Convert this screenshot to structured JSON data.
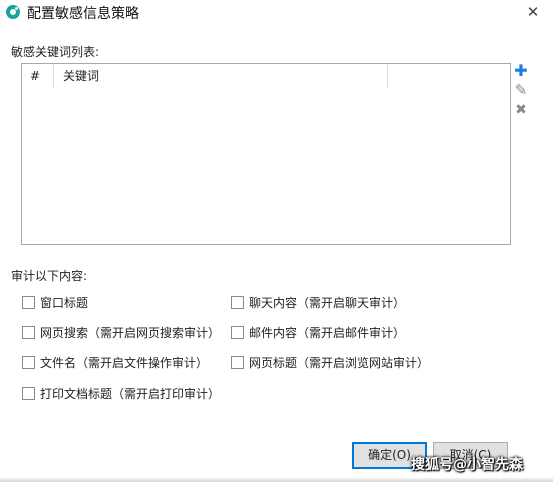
{
  "window": {
    "title": "配置敏感信息策略",
    "close_glyph": "✕",
    "app_icon": "app-logo-icon"
  },
  "keywords": {
    "label": "敏感关键词列表:",
    "columns": [
      "#",
      "关键词"
    ],
    "rows": [],
    "tools": {
      "add": {
        "icon": "plus-icon",
        "glyph": "✚",
        "color": "#1e7fd6"
      },
      "edit": {
        "icon": "pencil-icon",
        "glyph": "✎",
        "color": "#8a8a8a"
      },
      "delete": {
        "icon": "delete-x-icon",
        "glyph": "✖",
        "color": "#8a8a8a"
      }
    }
  },
  "audit": {
    "label": "审计以下内容:",
    "options": [
      {
        "label": "窗口标题",
        "checked": false
      },
      {
        "label": "聊天内容（需开启聊天审计）",
        "checked": false
      },
      {
        "label": "网页搜索（需开启网页搜索审计）",
        "checked": false
      },
      {
        "label": "邮件内容（需开启邮件审计）",
        "checked": false
      },
      {
        "label": "文件名（需开启文件操作审计）",
        "checked": false
      },
      {
        "label": "网页标题（需开启浏览网站审计）",
        "checked": false
      },
      {
        "label": "打印文档标题（需开启打印审计）",
        "checked": false
      }
    ]
  },
  "buttons": {
    "ok": "确定(O)",
    "cancel": "取消(C)"
  },
  "watermark": "搜狐号@小智先森",
  "colors": {
    "accent": "#0078d7",
    "icon_teal": "#1aa39a"
  }
}
